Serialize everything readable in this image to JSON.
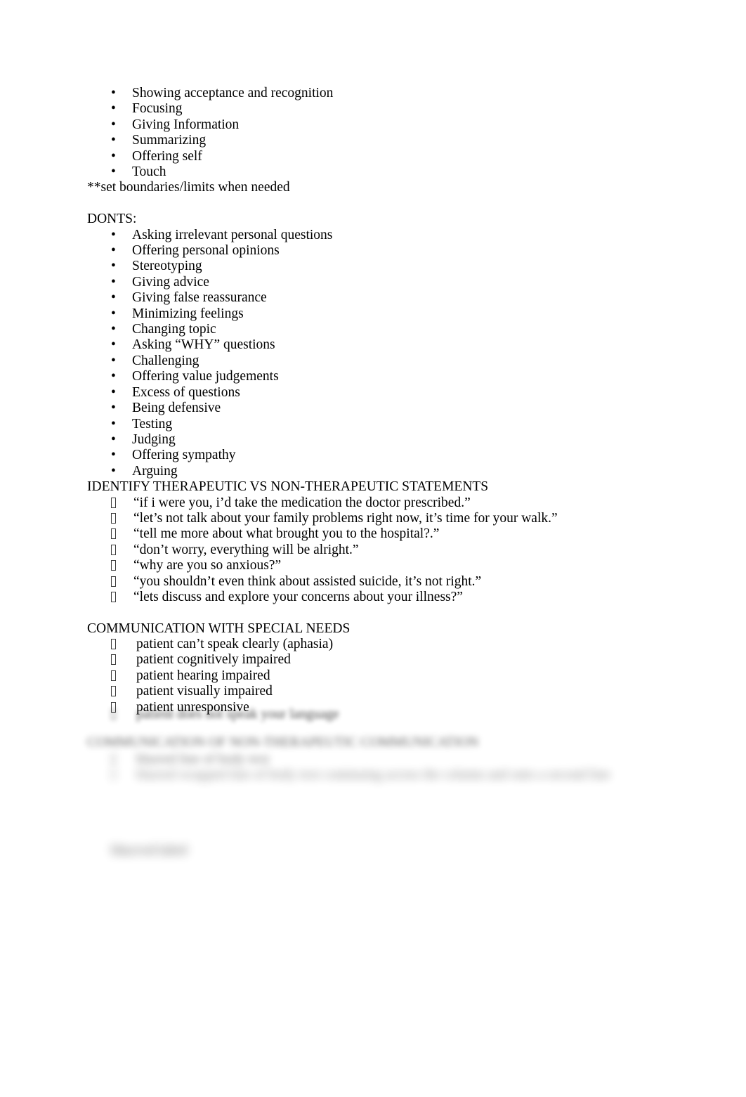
{
  "document": {
    "background_color": "#ffffff",
    "text_color": "#000000"
  },
  "sections": {
    "dos_tail": {
      "items": [
        "Showing acceptance and recognition",
        "Focusing",
        "Giving Information",
        "Summarizing",
        "Offering self",
        "Touch"
      ],
      "note": "**set boundaries/limits when needed"
    },
    "donts": {
      "heading": "DONTS:",
      "items": [
        "Asking irrelevant personal questions",
        "Offering personal opinions",
        "Stereotyping",
        "Giving advice",
        "Giving false reassurance",
        "Minimizing feelings",
        "Changing topic",
        "Asking “WHY” questions",
        "Challenging",
        "Offering value judgements",
        "Excess of questions",
        "Being defensive",
        "Testing",
        "Judging",
        "Offering sympathy",
        "Arguing"
      ]
    },
    "identify": {
      "heading": "IDENTIFY THERAPEUTIC VS NON-THERAPEUTIC STATEMENTS",
      "items": [
        "“if i were you, i’d take the medication the doctor prescribed.”",
        "“let’s not talk about your family problems right now, it’s time for your walk.”",
        "“tell me more about what brought you to the hospital?.”",
        "“don’t worry, everything will be alright.”",
        "“why are you so anxious?”",
        "“you shouldn’t even think about assisted suicide, it’s not right.”",
        "“lets discuss and explore your concerns about your illness?”"
      ]
    },
    "special_needs": {
      "heading": "COMMUNICATION WITH SPECIAL NEEDS",
      "items": [
        "patient can’t speak clearly (aphasia)",
        "patient cognitively impaired",
        "patient hearing impaired",
        "patient visually impaired",
        "patient unresponsive"
      ]
    },
    "obscured": {
      "special_needs_last_item": "patient does not speak your language",
      "heading": "COMMUNICATION OF NON-THERAPEUTIC COMMUNICATION",
      "items": [
        "blurred line of body text",
        "blurred wrapped line of body text continuing across the column and onto a second line"
      ],
      "footer": "blurred label"
    }
  },
  "markers": {
    "dot": "•",
    "box": "box-glyph"
  }
}
